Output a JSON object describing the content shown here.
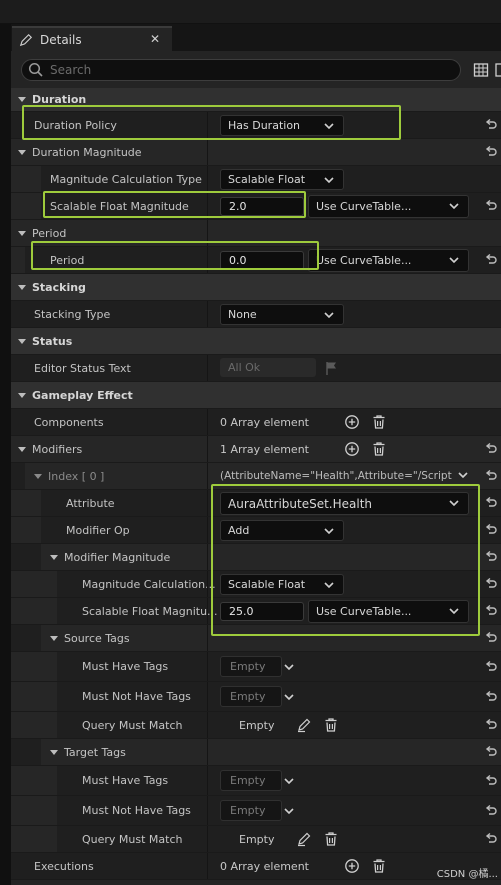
{
  "window": {
    "tab_title": "Details",
    "close_glyph": "✕"
  },
  "search": {
    "placeholder": "Search"
  },
  "sections": {
    "duration": {
      "header": "Duration",
      "duration_policy": {
        "label": "Duration Policy",
        "value": "Has Duration"
      }
    },
    "duration_magnitude": {
      "header": "Duration Magnitude",
      "calc_type": {
        "label": "Magnitude Calculation Type",
        "value": "Scalable Float"
      },
      "scalable": {
        "label": "Scalable Float Magnitude",
        "value": "2.0",
        "curve": "Use CurveTable..."
      }
    },
    "period": {
      "header": "Period",
      "period": {
        "label": "Period",
        "value": "0.0",
        "curve": "Use CurveTable..."
      }
    },
    "stacking": {
      "header": "Stacking",
      "stacking_type": {
        "label": "Stacking Type",
        "value": "None"
      }
    },
    "status": {
      "header": "Status",
      "editor_status": {
        "label": "Editor Status Text",
        "value": "All Ok"
      }
    },
    "gameplay_effect": {
      "header": "Gameplay Effect",
      "components": {
        "label": "Components",
        "value": "0 Array element"
      },
      "modifiers": {
        "label": "Modifiers",
        "value": "1 Array element"
      },
      "index0": {
        "label": "Index [ 0 ]",
        "value": "(AttributeName=\"Health\",Attribute=\"/Script"
      },
      "attribute": {
        "label": "Attribute",
        "value": "AuraAttributeSet.Health"
      },
      "modifier_op": {
        "label": "Modifier Op",
        "value": "Add"
      },
      "modifier_magnitude": {
        "label": "Modifier Magnitude"
      },
      "mm_calc": {
        "label": "Magnitude Calculation...",
        "value": "Scalable Float"
      },
      "mm_scalable": {
        "label": "Scalable Float Magnitu...",
        "value": "25.0",
        "curve": "Use CurveTable..."
      },
      "source_tags": {
        "label": "Source Tags",
        "must_have": {
          "label": "Must Have Tags",
          "value": "Empty"
        },
        "must_not_have": {
          "label": "Must Not Have Tags",
          "value": "Empty"
        },
        "query": {
          "label": "Query Must Match",
          "value": "Empty"
        }
      },
      "target_tags": {
        "label": "Target Tags",
        "must_have": {
          "label": "Must Have Tags",
          "value": "Empty"
        },
        "must_not_have": {
          "label": "Must Not Have Tags",
          "value": "Empty"
        },
        "query": {
          "label": "Query Must Match",
          "value": "Empty"
        }
      },
      "executions": {
        "label": "Executions",
        "value": "0 Array element"
      }
    }
  },
  "watermark": "CSDN @橘...",
  "colors": {
    "highlight": "#9ecb3c",
    "panel": "#242424",
    "input_bg": "#0e0e0e"
  }
}
